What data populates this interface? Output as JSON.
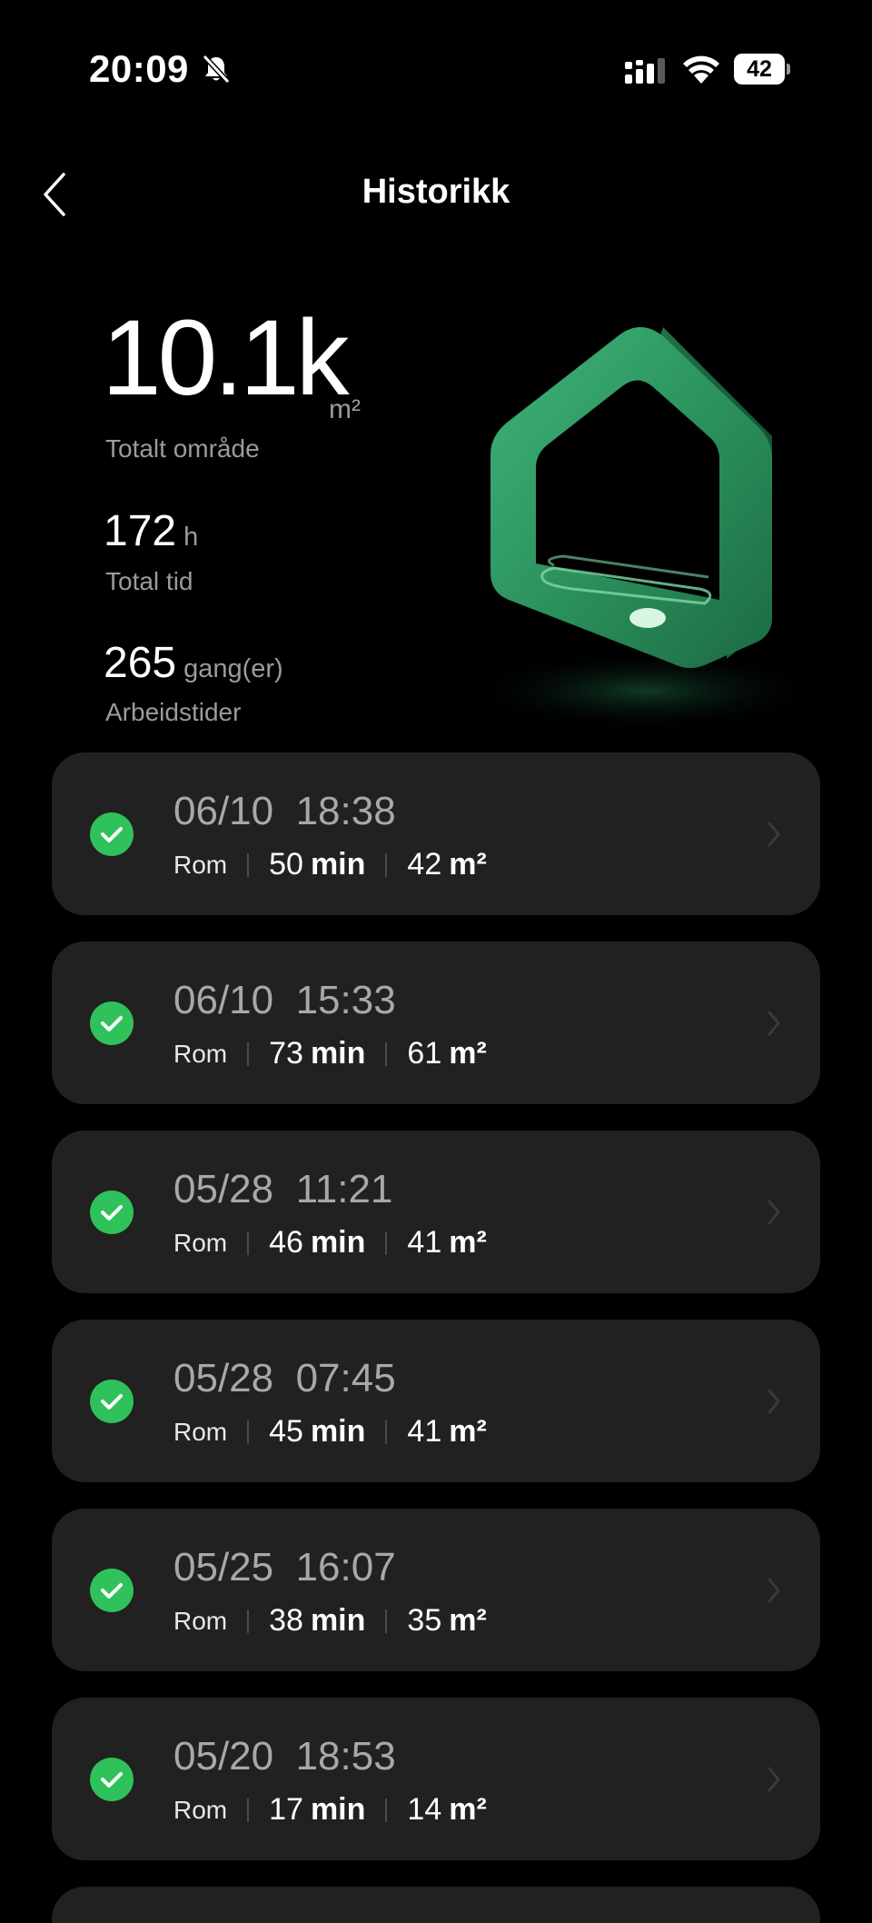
{
  "status_bar": {
    "time": "20:09",
    "battery": "42"
  },
  "header": {
    "title": "Historikk"
  },
  "summary": {
    "total_area_value": "10.1k",
    "total_area_unit": "m²",
    "total_area_label": "Totalt område",
    "total_time_value": "172",
    "total_time_unit": "h",
    "total_time_label": "Total tid",
    "work_count_value": "265",
    "work_count_unit": "gang(er)",
    "work_count_label": "Arbeidstider"
  },
  "records": [
    {
      "date": "06/10",
      "time": "18:38",
      "mode": "Rom",
      "duration": "50",
      "duration_unit": "min",
      "area": "42",
      "area_unit": "m²"
    },
    {
      "date": "06/10",
      "time": "15:33",
      "mode": "Rom",
      "duration": "73",
      "duration_unit": "min",
      "area": "61",
      "area_unit": "m²"
    },
    {
      "date": "05/28",
      "time": "11:21",
      "mode": "Rom",
      "duration": "46",
      "duration_unit": "min",
      "area": "41",
      "area_unit": "m²"
    },
    {
      "date": "05/28",
      "time": "07:45",
      "mode": "Rom",
      "duration": "45",
      "duration_unit": "min",
      "area": "41",
      "area_unit": "m²"
    },
    {
      "date": "05/25",
      "time": "16:07",
      "mode": "Rom",
      "duration": "38",
      "duration_unit": "min",
      "area": "35",
      "area_unit": "m²"
    },
    {
      "date": "05/20",
      "time": "18:53",
      "mode": "Rom",
      "duration": "17",
      "duration_unit": "min",
      "area": "14",
      "area_unit": "m²"
    }
  ],
  "colors": {
    "accent_green": "#2fc25a",
    "card_bg": "#212121",
    "house_green": "#2e9a63"
  }
}
